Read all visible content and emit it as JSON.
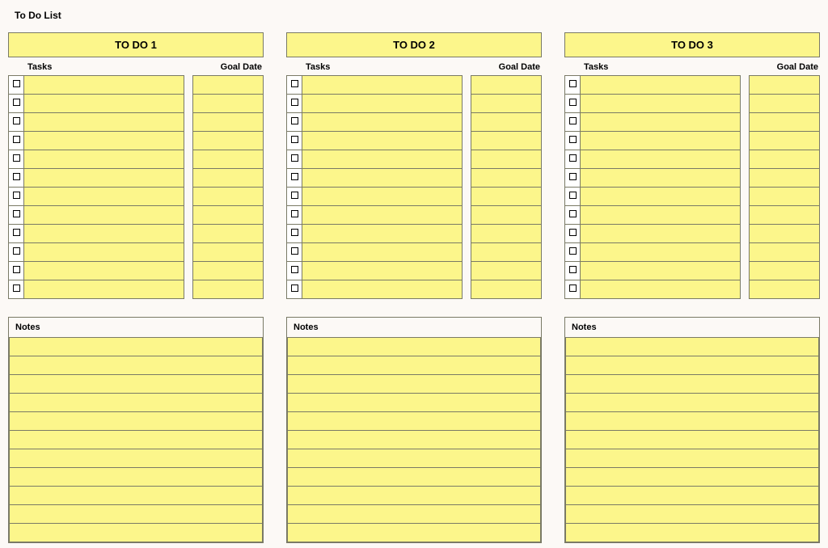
{
  "title": "To Do List",
  "headers": {
    "tasks": "Tasks",
    "goalDate": "Goal Date",
    "notes": "Notes"
  },
  "columns": [
    {
      "title": "TO DO 1",
      "rows": 12,
      "noteLines": 11,
      "tasks": [
        "",
        "",
        "",
        "",
        "",
        "",
        "",
        "",
        "",
        "",
        "",
        ""
      ],
      "dates": [
        "",
        "",
        "",
        "",
        "",
        "",
        "",
        "",
        "",
        "",
        "",
        ""
      ]
    },
    {
      "title": "TO DO 2",
      "rows": 12,
      "noteLines": 11,
      "tasks": [
        "",
        "",
        "",
        "",
        "",
        "",
        "",
        "",
        "",
        "",
        "",
        ""
      ],
      "dates": [
        "",
        "",
        "",
        "",
        "",
        "",
        "",
        "",
        "",
        "",
        "",
        ""
      ]
    },
    {
      "title": "TO DO 3",
      "rows": 12,
      "noteLines": 11,
      "tasks": [
        "",
        "",
        "",
        "",
        "",
        "",
        "",
        "",
        "",
        "",
        "",
        ""
      ],
      "dates": [
        "",
        "",
        "",
        "",
        "",
        "",
        "",
        "",
        "",
        "",
        "",
        ""
      ]
    }
  ]
}
